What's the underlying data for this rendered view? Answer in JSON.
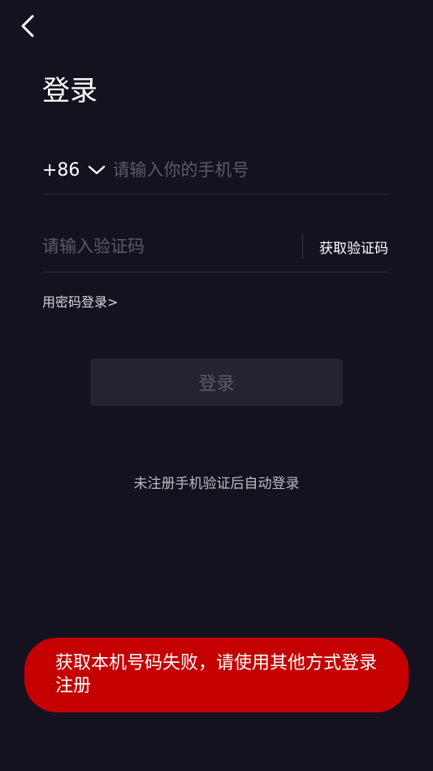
{
  "header": {
    "back_icon": "chevron-left-icon",
    "title": "登录"
  },
  "phone": {
    "country_code": "+86",
    "dropdown_icon": "chevron-down-icon",
    "placeholder": "请输入你的手机号",
    "value": ""
  },
  "verification": {
    "placeholder": "请输入验证码",
    "value": "",
    "get_code_label": "获取验证码"
  },
  "password_login_link": "用密码登录>",
  "login_button_label": "登录",
  "notice": "未注册手机验证后自动登录",
  "toast": {
    "message": "获取本机号码失败，请使用其他方式登录注册"
  },
  "colors": {
    "background": "#15121f",
    "toast": "#c40000",
    "disabled_button": "#252330"
  }
}
